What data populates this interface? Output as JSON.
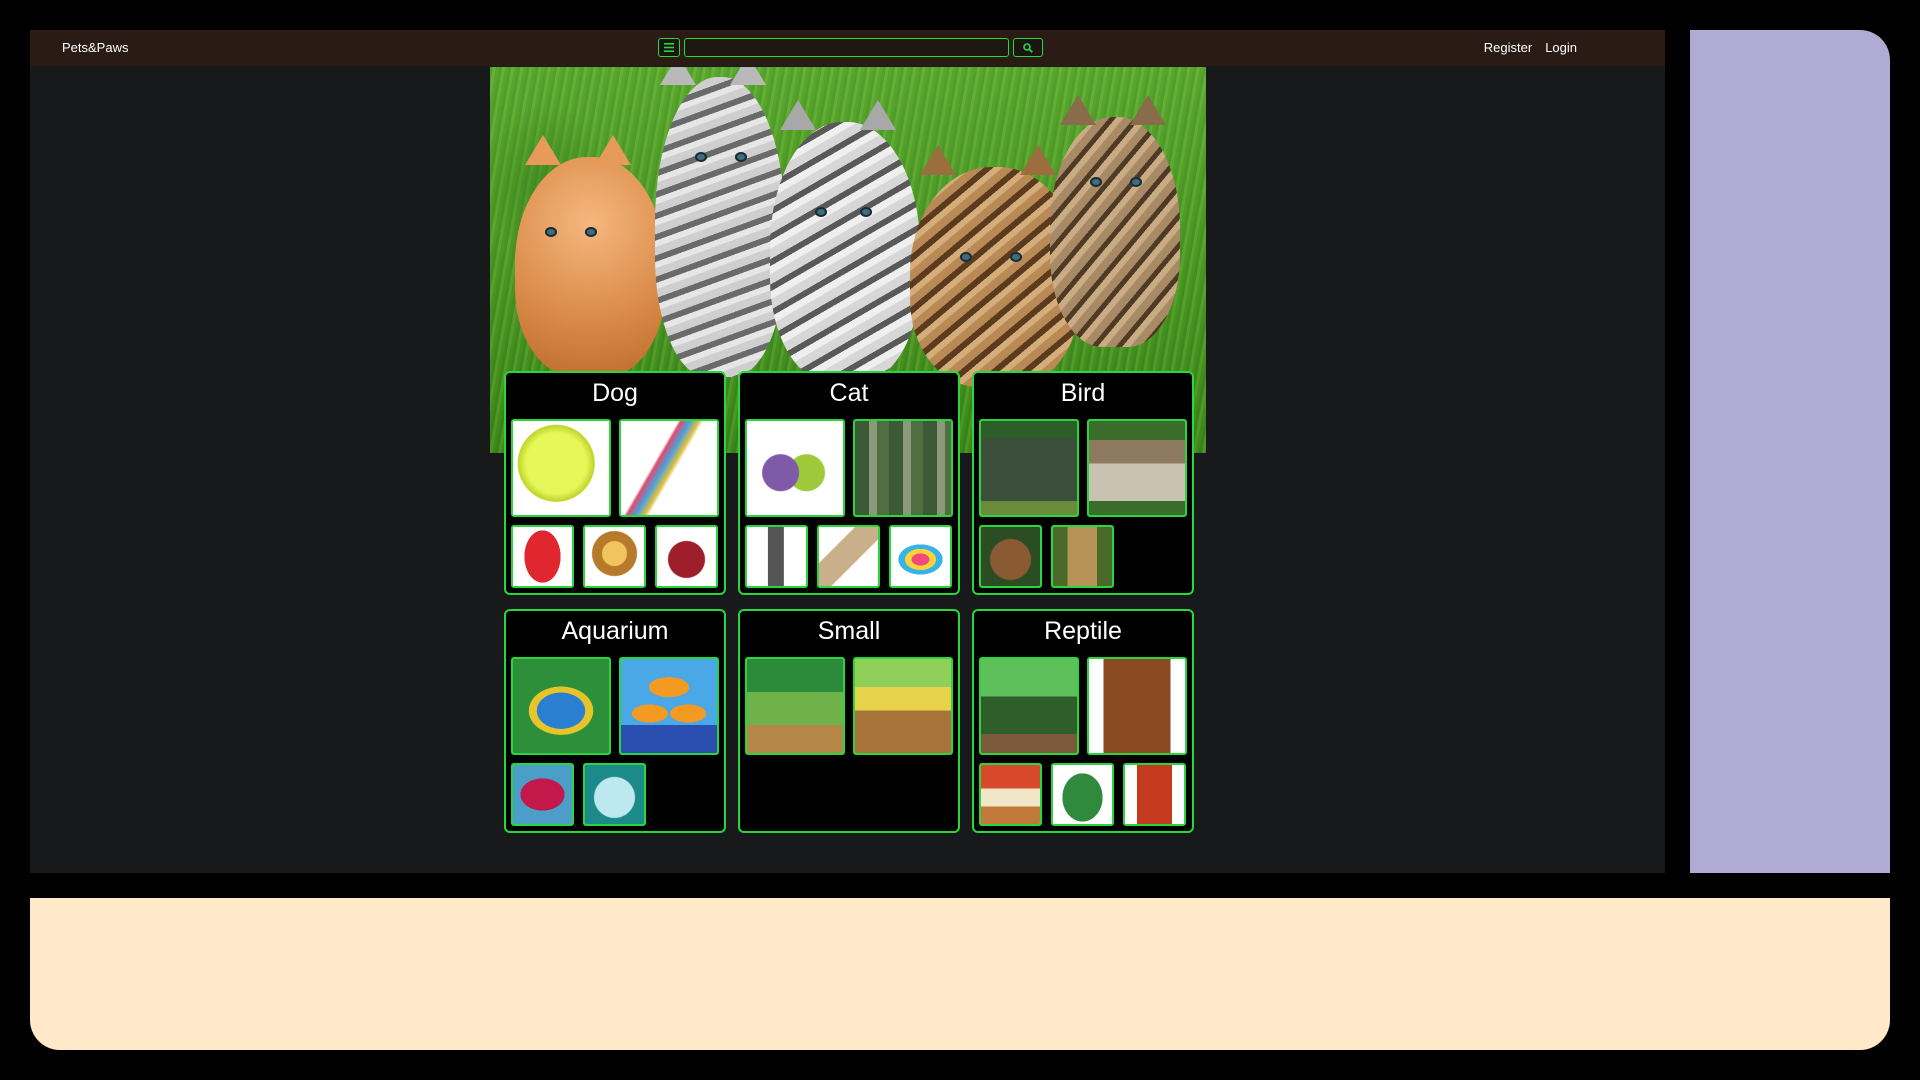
{
  "navbar": {
    "brand": "Pets&Paws",
    "search_placeholder": "",
    "register_label": "Register",
    "login_label": "Login"
  },
  "hero": {
    "alt": "kittens on grass"
  },
  "categories": [
    {
      "title": "Dog"
    },
    {
      "title": "Cat"
    },
    {
      "title": "Bird"
    },
    {
      "title": "Aquarium"
    },
    {
      "title": "Small"
    },
    {
      "title": "Reptile"
    }
  ],
  "icons": {
    "menu": "hamburger-icon",
    "search": "magnifier-icon"
  },
  "colors": {
    "accent": "#27d73b",
    "navbar": "#2a1c14",
    "page": "#18191b",
    "side_panel": "#afabd3",
    "bottom_panel": "#ffe9c8"
  }
}
